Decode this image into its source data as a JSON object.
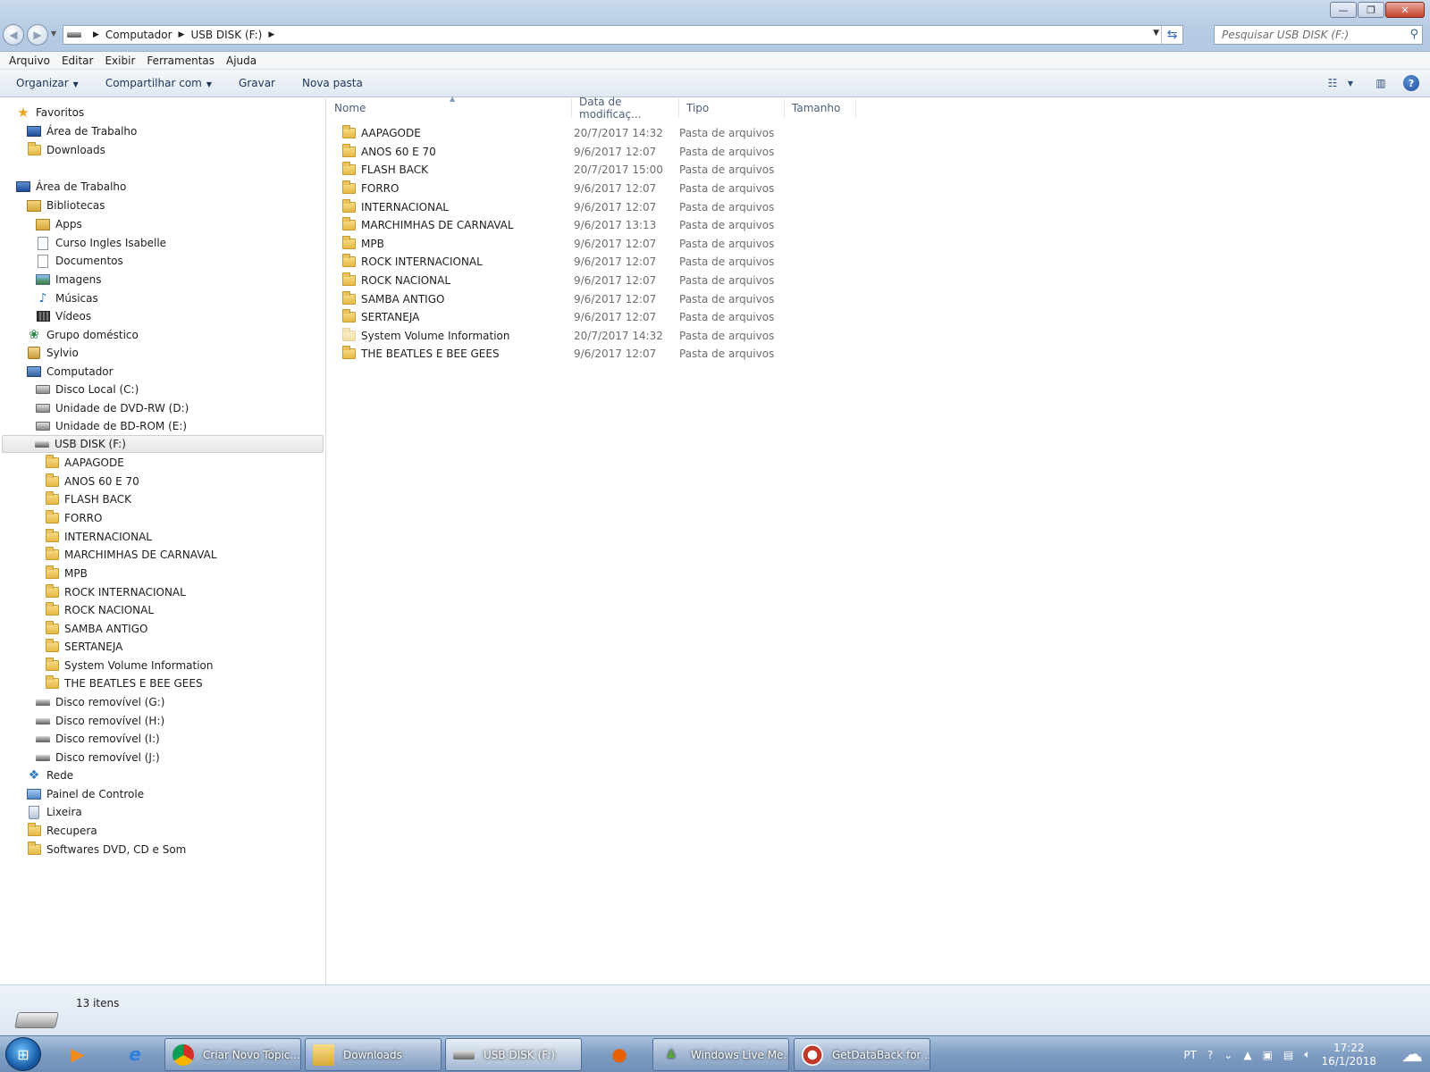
{
  "window": {
    "minimize": "—",
    "maximize": "❐",
    "close": "✕"
  },
  "address": {
    "crumbs": [
      "Computador",
      "USB DISK (F:)"
    ],
    "search_placeholder": "Pesquisar USB DISK (F:)"
  },
  "menu": [
    "Arquivo",
    "Editar",
    "Exibir",
    "Ferramentas",
    "Ajuda"
  ],
  "toolbar": {
    "organize": "Organizar",
    "share": "Compartilhar com",
    "burn": "Gravar",
    "new_folder": "Nova pasta"
  },
  "nav": {
    "favorites": "Favoritos",
    "fav_desktop": "Área de Trabalho",
    "fav_downloads": "Downloads",
    "desktop": "Área de Trabalho",
    "libraries": "Bibliotecas",
    "apps": "Apps",
    "curso": "Curso Ingles Isabelle",
    "documents": "Documentos",
    "images": "Imagens",
    "music": "Músicas",
    "videos": "Vídeos",
    "homegroup": "Grupo doméstico",
    "user": "Sylvio",
    "computer": "Computador",
    "local_disk": "Disco Local (C:)",
    "dvd": "Unidade de DVD-RW (D:)",
    "bd": "Unidade de BD-ROM (E:)",
    "usb": "USB DISK (F:)",
    "usb_children": [
      "AAPAGODE",
      "ANOS 60 E 70",
      "FLASH BACK",
      "FORRO",
      "INTERNACIONAL",
      "MARCHIMHAS DE CARNAVAL",
      "MPB",
      "ROCK INTERNACIONAL",
      "ROCK NACIONAL",
      "SAMBA ANTIGO",
      "SERTANEJA",
      "System Volume Information",
      "THE BEATLES E BEE GEES"
    ],
    "removable_g": "Disco removível (G:)",
    "removable_h": "Disco removível (H:)",
    "removable_i": "Disco removível (I:)",
    "removable_j": "Disco removível (J:)",
    "network": "Rede",
    "control_panel": "Painel de Controle",
    "recycle": "Lixeira",
    "recupera": "Recupera",
    "softwares": "Softwares DVD, CD e Som"
  },
  "columns": {
    "name": "Nome",
    "date": "Data de modificaç...",
    "type": "Tipo",
    "size": "Tamanho"
  },
  "files": [
    {
      "name": "AAPAGODE",
      "date": "20/7/2017 14:32",
      "type": "Pasta de arquivos"
    },
    {
      "name": "ANOS 60 E 70",
      "date": "9/6/2017 12:07",
      "type": "Pasta de arquivos"
    },
    {
      "name": "FLASH BACK",
      "date": "20/7/2017 15:00",
      "type": "Pasta de arquivos"
    },
    {
      "name": "FORRO",
      "date": "9/6/2017 12:07",
      "type": "Pasta de arquivos"
    },
    {
      "name": "INTERNACIONAL",
      "date": "9/6/2017 12:07",
      "type": "Pasta de arquivos"
    },
    {
      "name": "MARCHIMHAS DE CARNAVAL",
      "date": "9/6/2017 13:13",
      "type": "Pasta de arquivos"
    },
    {
      "name": "MPB",
      "date": "9/6/2017 12:07",
      "type": "Pasta de arquivos"
    },
    {
      "name": "ROCK INTERNACIONAL",
      "date": "9/6/2017 12:07",
      "type": "Pasta de arquivos"
    },
    {
      "name": "ROCK NACIONAL",
      "date": "9/6/2017 12:07",
      "type": "Pasta de arquivos"
    },
    {
      "name": "SAMBA ANTIGO",
      "date": "9/6/2017 12:07",
      "type": "Pasta de arquivos"
    },
    {
      "name": "SERTANEJA",
      "date": "9/6/2017 12:07",
      "type": "Pasta de arquivos"
    },
    {
      "name": "System Volume Information",
      "date": "20/7/2017 14:32",
      "type": "Pasta de arquivos"
    },
    {
      "name": "THE BEATLES E BEE GEES",
      "date": "9/6/2017 12:07",
      "type": "Pasta de arquivos"
    }
  ],
  "status": {
    "count": "13 itens"
  },
  "taskbar": {
    "chrome": "Criar Novo Tópic...",
    "downloads": "Downloads",
    "usb": "USB DISK (F:)",
    "wlm": "Windows Live Me...",
    "getdataback": "GetDataBack for ...",
    "lang": "PT",
    "time": "17:22",
    "date": "16/1/2018"
  },
  "icons": {
    "start": "windows-orb-icon",
    "media_player": "media-player-icon",
    "ie": "internet-explorer-icon",
    "firefox": "firefox-icon",
    "weather": "weather-cloud-icon"
  },
  "colors": {
    "folder": "#e6b844",
    "accent": "#1e3559",
    "taskbar": "#7f9cc2"
  }
}
